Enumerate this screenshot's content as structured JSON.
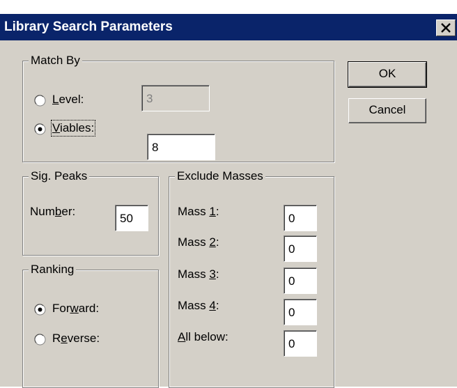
{
  "window": {
    "title": "Library Search Parameters"
  },
  "match_by": {
    "legend": "Match By",
    "level": {
      "label_pre": "",
      "label_key": "L",
      "label_post": "evel:",
      "value": "3",
      "selected": false,
      "enabled": false
    },
    "viables": {
      "label_pre": "",
      "label_key": "V",
      "label_post": "iables:",
      "value": "8",
      "selected": true
    }
  },
  "sig_peaks": {
    "legend": "Sig. Peaks",
    "number": {
      "label_pre": "Num",
      "label_key": "b",
      "label_post": "er:",
      "value": "50"
    }
  },
  "ranking": {
    "legend": "Ranking",
    "forward": {
      "label_pre": "For",
      "label_key": "w",
      "label_post": "ard:",
      "selected": true
    },
    "reverse": {
      "label_pre": "R",
      "label_key": "e",
      "label_post": "verse:",
      "selected": false
    }
  },
  "exclude_masses": {
    "legend": "Exclude Masses",
    "mass1": {
      "label_pre": "Mass ",
      "label_key": "1",
      "label_post": ":",
      "value": "0"
    },
    "mass2": {
      "label_pre": "Mass ",
      "label_key": "2",
      "label_post": ":",
      "value": "0"
    },
    "mass3": {
      "label_pre": "Mass ",
      "label_key": "3",
      "label_post": ":",
      "value": "0"
    },
    "mass4": {
      "label_pre": "Mass ",
      "label_key": "4",
      "label_post": ":",
      "value": "0"
    },
    "all_below": {
      "label_pre": "",
      "label_key": "A",
      "label_post": "ll below:",
      "value": "0"
    }
  },
  "buttons": {
    "ok": "OK",
    "cancel": "Cancel"
  },
  "icons": {
    "close": "close-icon",
    "radio_selected": "radio-selected-icon",
    "radio_unselected": "radio-unselected-icon"
  },
  "colors": {
    "title_bar": "#0a246a",
    "face": "#d4d0c8"
  }
}
